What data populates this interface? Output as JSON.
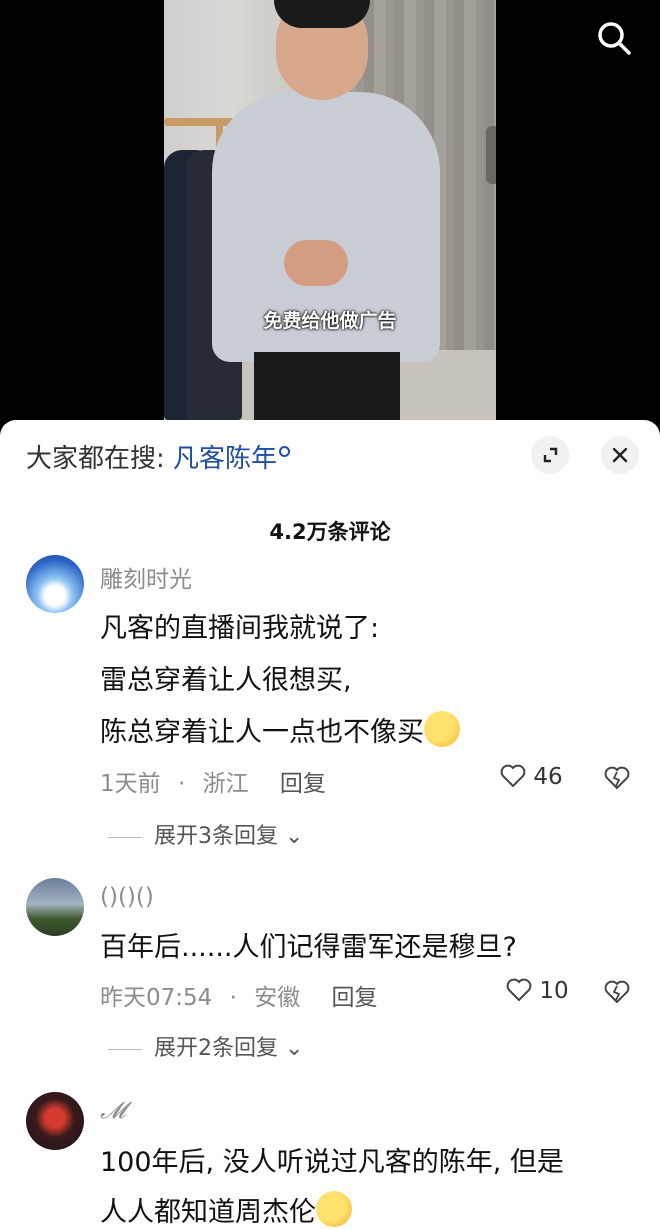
{
  "video": {
    "caption": "免费给他做广告",
    "search_icon": "search-icon"
  },
  "sheet": {
    "search_prefix": "大家都在搜:",
    "search_keyword": "凡客陈年",
    "comment_count": "4.2万条评论",
    "icons": {
      "expand": "expand-icon",
      "close": "close-icon"
    }
  },
  "comments": [
    {
      "username": "雕刻时光",
      "lines": [
        "凡客的直播间我就说了:",
        "雷总穿着让人很想买,",
        "陈总穿着让人一点也不像买"
      ],
      "time": "1天前",
      "sep": "·",
      "location": "浙江",
      "reply_label": "回复",
      "likes": "46",
      "expand_label": "展开3条回复"
    },
    {
      "username": "()()()",
      "lines": [
        "百年后......人们记得雷军还是穆旦?"
      ],
      "time": "昨天07:54",
      "sep": "·",
      "location": "安徽",
      "reply_label": "回复",
      "likes": "10",
      "expand_label": "展开2条回复"
    },
    {
      "username": "𝓜",
      "lines": [
        "100年后, 没人听说过凡客的陈年, 但是",
        "人人都知道周杰伦"
      ]
    }
  ],
  "colors": {
    "keyword": "#1f4fa0",
    "meta": "#8c8c8c",
    "sheet_bg": "#ffffff"
  }
}
